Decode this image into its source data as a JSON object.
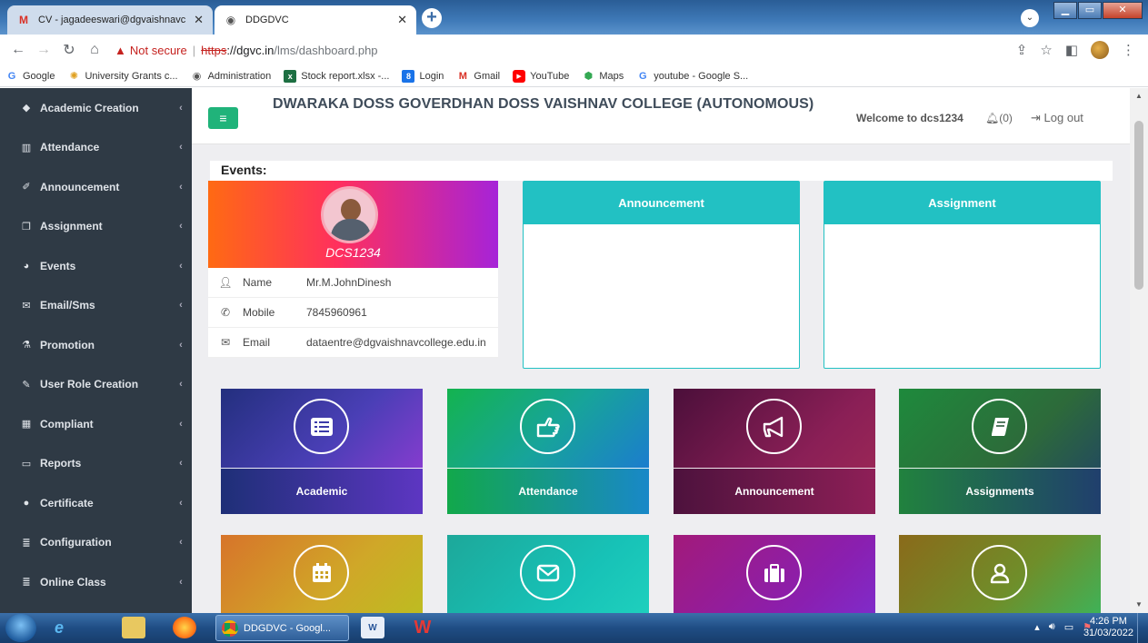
{
  "browser": {
    "tabs": [
      {
        "title": "CV - jagadeeswari@dgvaishnavc",
        "icon": "gmail-icon",
        "active": false
      },
      {
        "title": "DDGDVC",
        "icon": "globe-icon",
        "active": true
      }
    ],
    "url": {
      "warning": "Not secure",
      "scheme": "https",
      "host": "://dgvc.in",
      "path": "/lms/dashboard.php"
    },
    "bookmarks": [
      {
        "label": "Google",
        "icon": "google-icon",
        "color": "#4285f4"
      },
      {
        "label": "University Grants c...",
        "icon": "ugc-icon",
        "color": "#e0a020"
      },
      {
        "label": "Administration",
        "icon": "globe-icon",
        "color": "#555555"
      },
      {
        "label": "Stock report.xlsx -...",
        "icon": "excel-icon",
        "color": "#1d6f42"
      },
      {
        "label": "Login",
        "icon": "login-icon",
        "color": "#1a73e8"
      },
      {
        "label": "Gmail",
        "icon": "gmail-icon",
        "color": "#d93025"
      },
      {
        "label": "YouTube",
        "icon": "youtube-icon",
        "color": "#ff0000"
      },
      {
        "label": "Maps",
        "icon": "maps-icon",
        "color": "#34a853"
      },
      {
        "label": "youtube - Google S...",
        "icon": "google-icon",
        "color": "#4285f4"
      }
    ]
  },
  "sidebar": {
    "items": [
      {
        "label": "Academic Creation",
        "icon": "diamond-icon"
      },
      {
        "label": "Attendance",
        "icon": "bar-chart-icon"
      },
      {
        "label": "Announcement",
        "icon": "magic-icon"
      },
      {
        "label": "Assignment",
        "icon": "clipboard-icon"
      },
      {
        "label": "Events",
        "icon": "pie-chart-icon"
      },
      {
        "label": "Email/Sms",
        "icon": "envelope-icon"
      },
      {
        "label": "Promotion",
        "icon": "flask-icon"
      },
      {
        "label": "User Role Creation",
        "icon": "edit-icon"
      },
      {
        "label": "Compliant",
        "icon": "table-icon"
      },
      {
        "label": "Reports",
        "icon": "monitor-icon"
      },
      {
        "label": "Certificate",
        "icon": "dot-icon"
      },
      {
        "label": "Configuration",
        "icon": "list-icon"
      },
      {
        "label": "Online Class",
        "icon": "list-icon"
      }
    ]
  },
  "header": {
    "title": "DWARAKA DOSS GOVERDHAN DOSS VAISHNAV COLLEGE (AUTONOMOUS)",
    "welcome": "Welcome to dcs1234",
    "notifications": "(0)",
    "logout": "Log out"
  },
  "events_label": "Events:",
  "profile": {
    "code": "DCS1234",
    "rows": [
      {
        "key": "Name",
        "value": "Mr.M.JohnDinesh",
        "icon": "user-icon"
      },
      {
        "key": "Mobile",
        "value": "7845960961",
        "icon": "phone-icon"
      },
      {
        "key": "Email",
        "value": "dataentre@dgvaishnavcollege.edu.in",
        "icon": "envelope-icon"
      }
    ]
  },
  "panels": {
    "announcement": "Announcement",
    "assignment": "Assignment"
  },
  "tiles": [
    {
      "label": "Academic",
      "icon": "list-icon"
    },
    {
      "label": "Attendance",
      "icon": "hand-pointer-icon"
    },
    {
      "label": "Announcement",
      "icon": "bullhorn-icon"
    },
    {
      "label": "Assignments",
      "icon": "book-icon"
    },
    {
      "label": "",
      "icon": "calendar-icon"
    },
    {
      "label": "",
      "icon": "envelope-icon"
    },
    {
      "label": "",
      "icon": "briefcase-icon"
    },
    {
      "label": "",
      "icon": "user-icon"
    }
  ],
  "taskbar": {
    "task_label": "DDGDVC - Googl...",
    "time": "4:26 PM",
    "date": "31/03/2022"
  }
}
